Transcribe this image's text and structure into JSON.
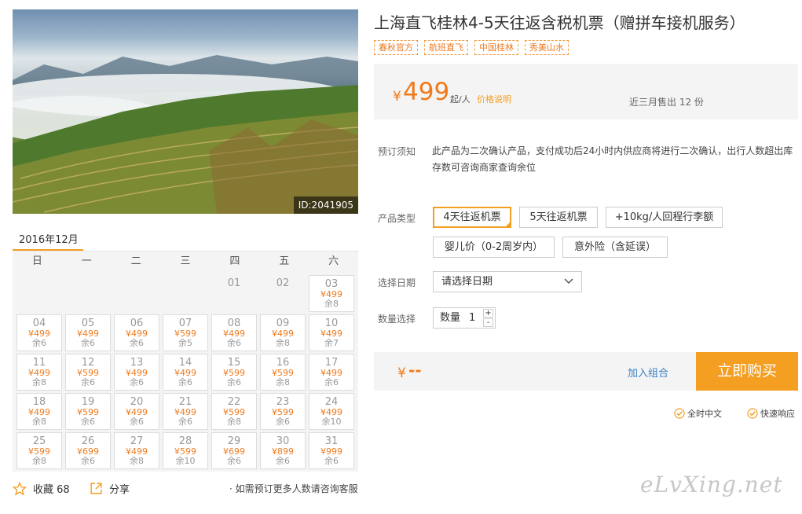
{
  "product": {
    "title": "上海直飞桂林4-5天往返含税机票（赠拼车接机服务）",
    "tags": [
      "春秋官方",
      "航班直飞",
      "中国桂林",
      "秀美山水"
    ],
    "photo_id": "ID:2041905"
  },
  "price": {
    "currency": "¥",
    "value": "499",
    "unit": "起/人",
    "note": "价格说明",
    "sold": "近三月售出 12 份"
  },
  "booking": {
    "notice_label": "预订须知",
    "notice_text": "此产品为二次确认产品，支付成功后24小时内供应商将进行二次确认，出行人数超出库存数可咨询商家查询余位",
    "type_label": "产品类型",
    "types": [
      "4天往返机票",
      "5天往返机票",
      "+10kg/人回程行李额",
      "婴儿价（0-2周岁内）",
      "意外险（含延误）"
    ],
    "date_label": "选择日期",
    "date_placeholder": "请选择日期",
    "qty_label": "数量选择",
    "qty_text": "数量",
    "qty_value": "1",
    "plus": "+",
    "minus": "-"
  },
  "buy": {
    "currency": "¥",
    "value": "--",
    "add_combo": "加入组合",
    "buy_now": "立即购买"
  },
  "services": [
    "全时中文",
    "快速响应"
  ],
  "calendar": {
    "month": "2016年12月",
    "weekdays": [
      "日",
      "一",
      "二",
      "三",
      "四",
      "五",
      "六"
    ],
    "days": [
      {
        "d": "01",
        "p": "",
        "s": ""
      },
      {
        "d": "02",
        "p": "",
        "s": ""
      },
      {
        "d": "03",
        "p": "¥499",
        "s": "余8"
      },
      {
        "d": "04",
        "p": "¥499",
        "s": "余6"
      },
      {
        "d": "05",
        "p": "¥499",
        "s": "余6"
      },
      {
        "d": "06",
        "p": "¥499",
        "s": "余6"
      },
      {
        "d": "07",
        "p": "¥599",
        "s": "余5"
      },
      {
        "d": "08",
        "p": "¥499",
        "s": "余6"
      },
      {
        "d": "09",
        "p": "¥499",
        "s": "余8"
      },
      {
        "d": "10",
        "p": "¥499",
        "s": "余7"
      },
      {
        "d": "11",
        "p": "¥499",
        "s": "余8"
      },
      {
        "d": "12",
        "p": "¥599",
        "s": "余6"
      },
      {
        "d": "13",
        "p": "¥499",
        "s": "余6"
      },
      {
        "d": "14",
        "p": "¥499",
        "s": "余6"
      },
      {
        "d": "15",
        "p": "¥599",
        "s": "余6"
      },
      {
        "d": "16",
        "p": "¥599",
        "s": "余8"
      },
      {
        "d": "17",
        "p": "¥499",
        "s": "余6"
      },
      {
        "d": "18",
        "p": "¥499",
        "s": "余8"
      },
      {
        "d": "19",
        "p": "¥599",
        "s": "余6"
      },
      {
        "d": "20",
        "p": "¥499",
        "s": "余6"
      },
      {
        "d": "21",
        "p": "¥499",
        "s": "余6"
      },
      {
        "d": "22",
        "p": "¥599",
        "s": "余8"
      },
      {
        "d": "23",
        "p": "¥599",
        "s": "余6"
      },
      {
        "d": "24",
        "p": "¥499",
        "s": "余10"
      },
      {
        "d": "25",
        "p": "¥599",
        "s": "余8"
      },
      {
        "d": "26",
        "p": "¥699",
        "s": "余6"
      },
      {
        "d": "27",
        "p": "¥499",
        "s": "余8"
      },
      {
        "d": "28",
        "p": "¥599",
        "s": "余10"
      },
      {
        "d": "29",
        "p": "¥699",
        "s": "余6"
      },
      {
        "d": "30",
        "p": "¥899",
        "s": "余6"
      },
      {
        "d": "31",
        "p": "¥999",
        "s": "余6"
      }
    ]
  },
  "actions": {
    "favorite_label": "收藏 68",
    "share_label": "分享",
    "tip": "· 如需预订更多人数请咨询客服"
  },
  "watermark": "eLvXing.net",
  "colors": {
    "accent": "#f49e22",
    "price": "#f07a1a",
    "link": "#3f7fc4"
  }
}
